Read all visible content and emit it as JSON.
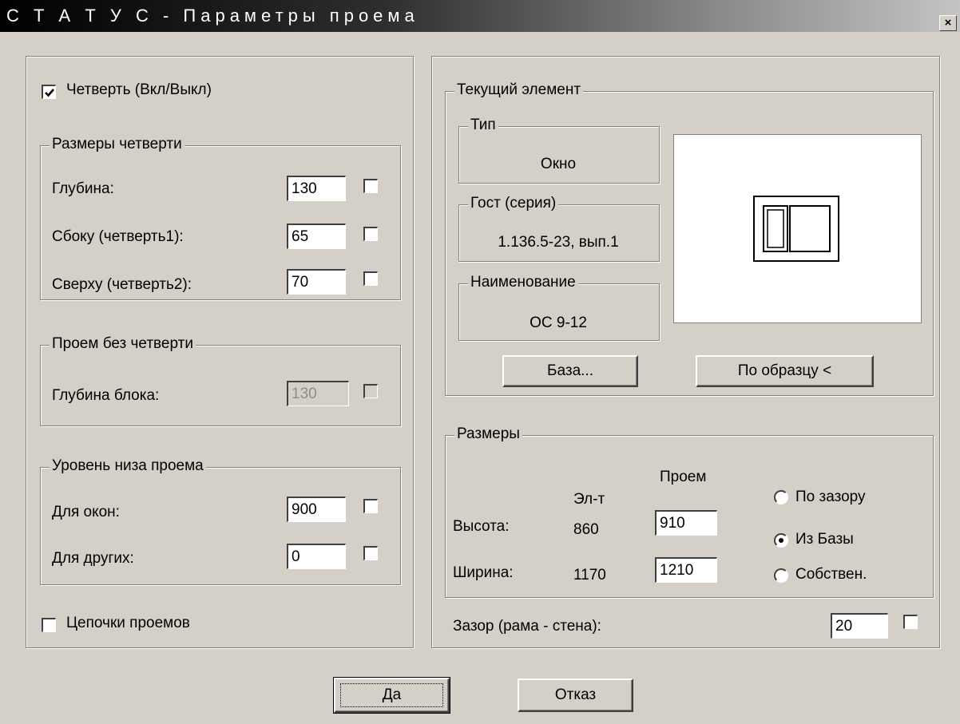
{
  "window": {
    "title": "С Т А Т У С - Параметры проема",
    "close_label": "×"
  },
  "left": {
    "quarter_toggle": {
      "label": "Четверть (Вкл/Выкл)",
      "checked": true
    },
    "quarter_sizes": {
      "legend": "Размеры четверти",
      "depth": {
        "label": "Глубина:",
        "value": "130"
      },
      "side": {
        "label": "Сбоку  (четверть1):",
        "value": "65"
      },
      "top": {
        "label": "Сверху (четверть2):",
        "value": "70"
      }
    },
    "no_quarter": {
      "legend": "Проем без четверти",
      "block_depth": {
        "label": "Глубина блока:",
        "value": "130"
      }
    },
    "bottom_level": {
      "legend": "Уровень низа проема",
      "windows": {
        "label": "Для окон:",
        "value": "900"
      },
      "others": {
        "label": "Для других:",
        "value": "0"
      }
    },
    "chains": {
      "label": "Цепочки проемов",
      "checked": false
    }
  },
  "right": {
    "current": {
      "legend": "Текущий элемент",
      "type": {
        "legend": "Тип",
        "value": "Окно"
      },
      "gost": {
        "legend": "Гост (серия)",
        "value": "1.136.5-23, вып.1"
      },
      "name": {
        "legend": "Наименование",
        "value": "ОС 9-12"
      },
      "base_button": "База...",
      "sample_button": "По образцу <"
    },
    "sizes": {
      "legend": "Размеры",
      "col_element": "Эл-т",
      "col_opening": "Проем",
      "height": {
        "label": "Высота:",
        "element": "860",
        "opening": "910"
      },
      "width": {
        "label": "Ширина:",
        "element": "1170",
        "opening": "1210"
      },
      "radio_options": [
        "По зазору",
        "Из Базы",
        "Собствен."
      ],
      "radio_selected": "Из Базы"
    },
    "gap": {
      "label": "Зазор (рама - стена):",
      "value": "20"
    }
  },
  "buttons": {
    "ok": "Да",
    "cancel": "Отказ"
  }
}
